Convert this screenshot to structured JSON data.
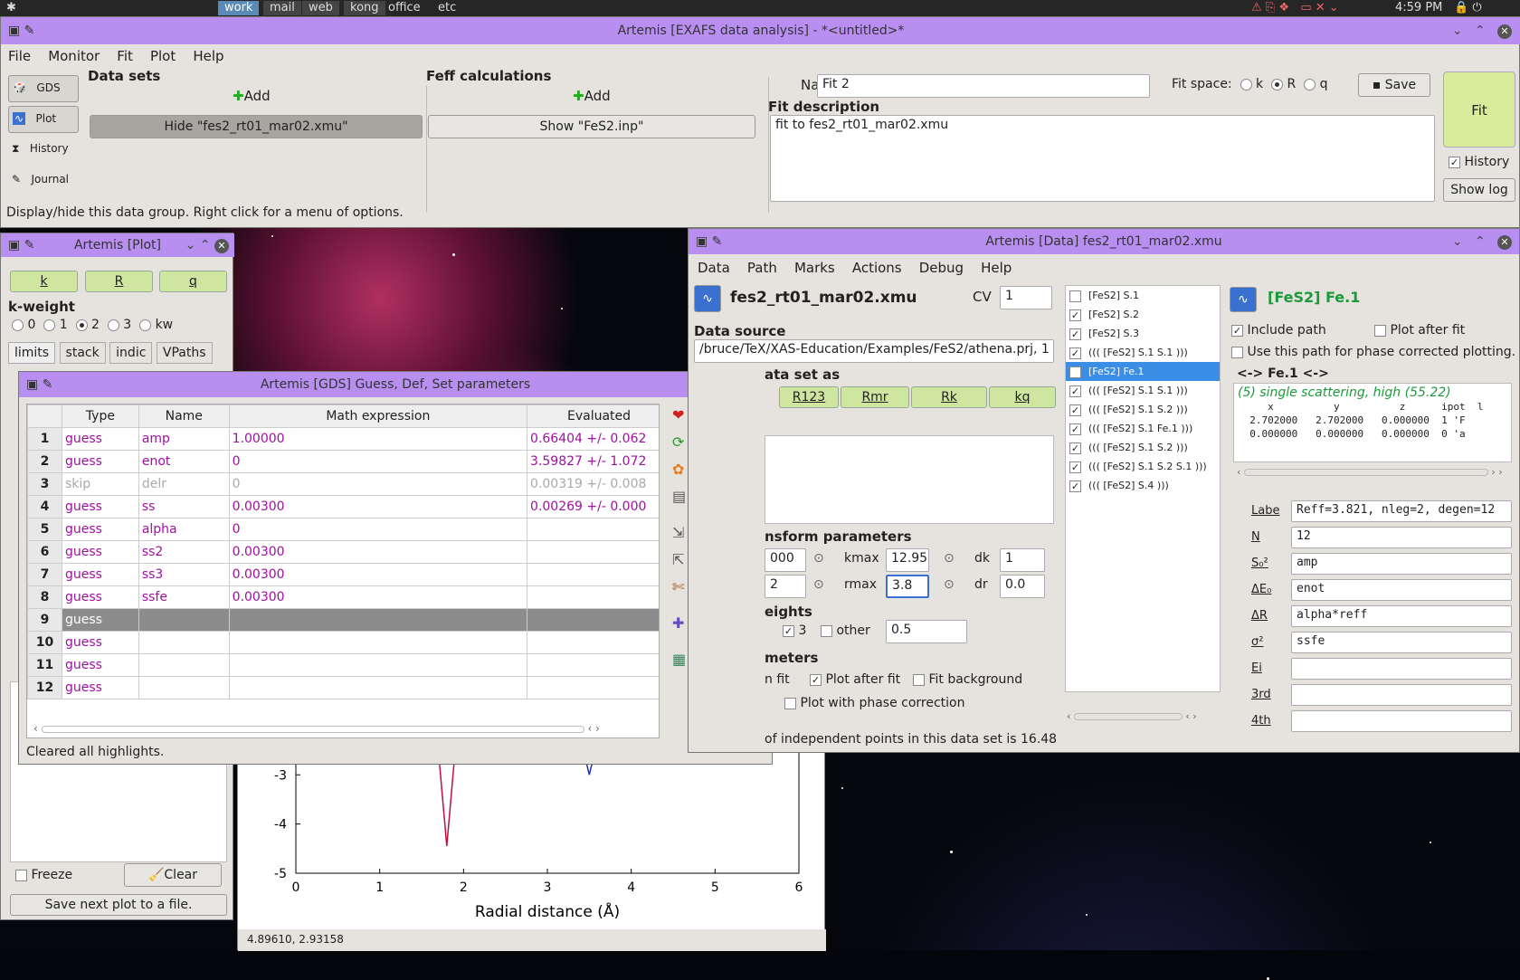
{
  "taskbar": {
    "logo": "✱",
    "workspaces": [
      "work",
      "mail",
      "web",
      "kong",
      "office",
      "etc"
    ],
    "active": "work",
    "time": "4:59 PM"
  },
  "main": {
    "title": "Artemis [EXAFS data analysis] - *<untitled>*",
    "menu": [
      "File",
      "Monitor",
      "Fit",
      "Plot",
      "Help"
    ],
    "sidebar": [
      "GDS",
      "Plot",
      "History",
      "Journal"
    ],
    "datasets_label": "Data sets",
    "feff_label": "Feff calculations",
    "add": "Add",
    "hide_btn": "Hide \"fes2_rt01_mar02.xmu\"",
    "show_btn": "Show \"FeS2.inp\"",
    "name_label": "Name",
    "name_value": "Fit 2",
    "fitspace_label": "Fit space:",
    "fitspace": [
      "k",
      "R",
      "q"
    ],
    "fitspace_sel": "R",
    "save": "Save",
    "fit": "Fit",
    "fitdesc_label": "Fit description",
    "fitdesc": "fit to fes2_rt01_mar02.xmu",
    "history": "History",
    "showlog": "Show log",
    "status": "Display/hide this data group.  Right click for a menu of options."
  },
  "plot": {
    "title": "Artemis [Plot]",
    "kbtns": [
      "k",
      "R",
      "q"
    ],
    "kweight_label": "k-weight",
    "kweights": [
      "0",
      "1",
      "2",
      "3",
      "kw"
    ],
    "kweight_sel": "2",
    "tabs": [
      "limits",
      "stack",
      "indic",
      "VPaths"
    ],
    "freeze": "Freeze",
    "clear": "Clear",
    "save": "Save next plot to a file."
  },
  "gds": {
    "title": "Artemis [GDS] Guess, Def, Set parameters",
    "headers": [
      "Type",
      "Name",
      "Math expression",
      "Evaluated"
    ],
    "rows": [
      {
        "n": "1",
        "type": "guess",
        "name": "amp",
        "expr": "1.00000",
        "eval": "0.66404 +/- 0.062"
      },
      {
        "n": "2",
        "type": "guess",
        "name": "enot",
        "expr": "0",
        "eval": "3.59827 +/- 1.072"
      },
      {
        "n": "3",
        "type": "skip",
        "name": "delr",
        "expr": "0",
        "eval": "0.00319 +/- 0.008"
      },
      {
        "n": "4",
        "type": "guess",
        "name": "ss",
        "expr": "0.00300",
        "eval": "0.00269 +/- 0.000"
      },
      {
        "n": "5",
        "type": "guess",
        "name": "alpha",
        "expr": "0",
        "eval": ""
      },
      {
        "n": "6",
        "type": "guess",
        "name": "ss2",
        "expr": "0.00300",
        "eval": ""
      },
      {
        "n": "7",
        "type": "guess",
        "name": "ss3",
        "expr": "0.00300",
        "eval": ""
      },
      {
        "n": "8",
        "type": "guess",
        "name": "ssfe",
        "expr": "0.00300",
        "eval": ""
      },
      {
        "n": "9",
        "type": "guess",
        "name": "",
        "expr": "",
        "eval": ""
      },
      {
        "n": "10",
        "type": "guess",
        "name": "",
        "expr": "",
        "eval": ""
      },
      {
        "n": "11",
        "type": "guess",
        "name": "",
        "expr": "",
        "eval": ""
      },
      {
        "n": "12",
        "type": "guess",
        "name": "",
        "expr": "",
        "eval": ""
      }
    ],
    "actions": [
      "Use best fit",
      "Reset all",
      "Highlight",
      "Evaluate",
      "Import GDS",
      "Export GDS",
      "Discard all",
      "Add GDS",
      "About: GDS"
    ],
    "status": "Cleared all highlights."
  },
  "data": {
    "title": "Artemis [Data] fes2_rt01_mar02.xmu",
    "menu": [
      "Data",
      "Path",
      "Marks",
      "Actions",
      "Debug",
      "Help"
    ],
    "file": "fes2_rt01_mar02.xmu",
    "cv_label": "CV",
    "cv": "1",
    "source_label": "Data source",
    "source": "/bruce/TeX/XAS-Education/Examples/FeS2/athena.prj, 1",
    "plotas_label": "ata set as",
    "plotbtns": [
      "R123",
      "Rmr",
      "Rk",
      "kq"
    ],
    "ft_label": "nsform parameters",
    "kmin": "000",
    "kmax_label": "kmax",
    "kmax": "12.95",
    "dk_label": "dk",
    "dk": "1",
    "rmin": "2",
    "rmax_label": "rmax",
    "rmax": "3.8",
    "dr_label": "dr",
    "dr": "0.0",
    "weights_label": "eights",
    "w3": "3",
    "other": "other",
    "other_val": "0.5",
    "params_label": "meters",
    "infit": "n fit",
    "plotafter": "Plot after fit",
    "fitbg": "Fit background",
    "phasecorr": "Plot with phase correction",
    "status": "of independent points in this data set is 16.48",
    "paths": [
      {
        "label": "[FeS2] S.1",
        "checked": false
      },
      {
        "label": "[FeS2] S.2",
        "checked": true
      },
      {
        "label": "[FeS2] S.3",
        "checked": true
      },
      {
        "label": "((( [FeS2] S.1 S.1  )))",
        "checked": true
      },
      {
        "label": "[FeS2] Fe.1",
        "checked": true,
        "selected": true
      },
      {
        "label": "((( [FeS2] S.1 S.1  )))",
        "checked": true
      },
      {
        "label": "((( [FeS2] S.1 S.2  )))",
        "checked": true
      },
      {
        "label": "((( [FeS2] S.1 Fe.1  )))",
        "checked": true
      },
      {
        "label": "((( [FeS2] S.1 S.2  )))",
        "checked": true
      },
      {
        "label": "((( [FeS2] S.1 S.2 S.1  )))",
        "checked": true
      },
      {
        "label": "((( [FeS2] S.4  )))",
        "checked": true
      }
    ],
    "path_title": "[FeS2] Fe.1",
    "include": "Include path",
    "plotafterfit": "Plot after fit",
    "phaseuse": "Use this path for phase corrected plotting.",
    "arrow": "<-> Fe.1  <->",
    "desc": "(5) single scattering, high (55.22)",
    "geom_header": "     x          y          z      ipot  l",
    "geom1": "  2.702000   2.702000   0.000000  1 'F",
    "geom2": "  0.000000   0.000000   0.000000  0 'a",
    "params": [
      {
        "label": "Labe",
        "value": "Reff=3.821, nleg=2, degen=12"
      },
      {
        "label": "N",
        "value": "12"
      },
      {
        "label": "S₀²",
        "value": "amp"
      },
      {
        "label": "ΔE₀",
        "value": "enot"
      },
      {
        "label": "ΔR",
        "value": "alpha*reff"
      },
      {
        "label": "σ²",
        "value": "ssfe"
      },
      {
        "label": "Ei",
        "value": ""
      },
      {
        "label": "3rd",
        "value": ""
      },
      {
        "label": "4th",
        "value": ""
      }
    ]
  },
  "chart_data": {
    "type": "line",
    "xlabel": "Radial distance   (Å)",
    "xlim": [
      0,
      6
    ],
    "ylim": [
      -5,
      -1.8
    ],
    "xticks": [
      "0",
      "1",
      "2",
      "3",
      "4",
      "5",
      "6"
    ],
    "yticks": [
      "-2",
      "-3",
      "-4",
      "-5"
    ],
    "series": [
      {
        "color": "#c01040",
        "x": [
          1.0,
          1.05,
          1.1,
          1.4,
          1.7,
          1.8,
          1.9,
          2.2
        ],
        "y": [
          -1.9,
          -2.1,
          -1.9,
          -1.8,
          -2.5,
          -4.45,
          -2.5,
          -1.8
        ]
      },
      {
        "color": "#2030c0",
        "x": [
          2.3,
          2.4,
          2.5,
          2.9,
          3.0,
          3.1,
          3.4,
          3.5,
          3.6
        ],
        "y": [
          -1.8,
          -2.1,
          -1.85,
          -2.1,
          -2.5,
          -2.1,
          -2.3,
          -3.0,
          -2.3
        ]
      }
    ],
    "coords": "4.89610,  2.93158"
  }
}
